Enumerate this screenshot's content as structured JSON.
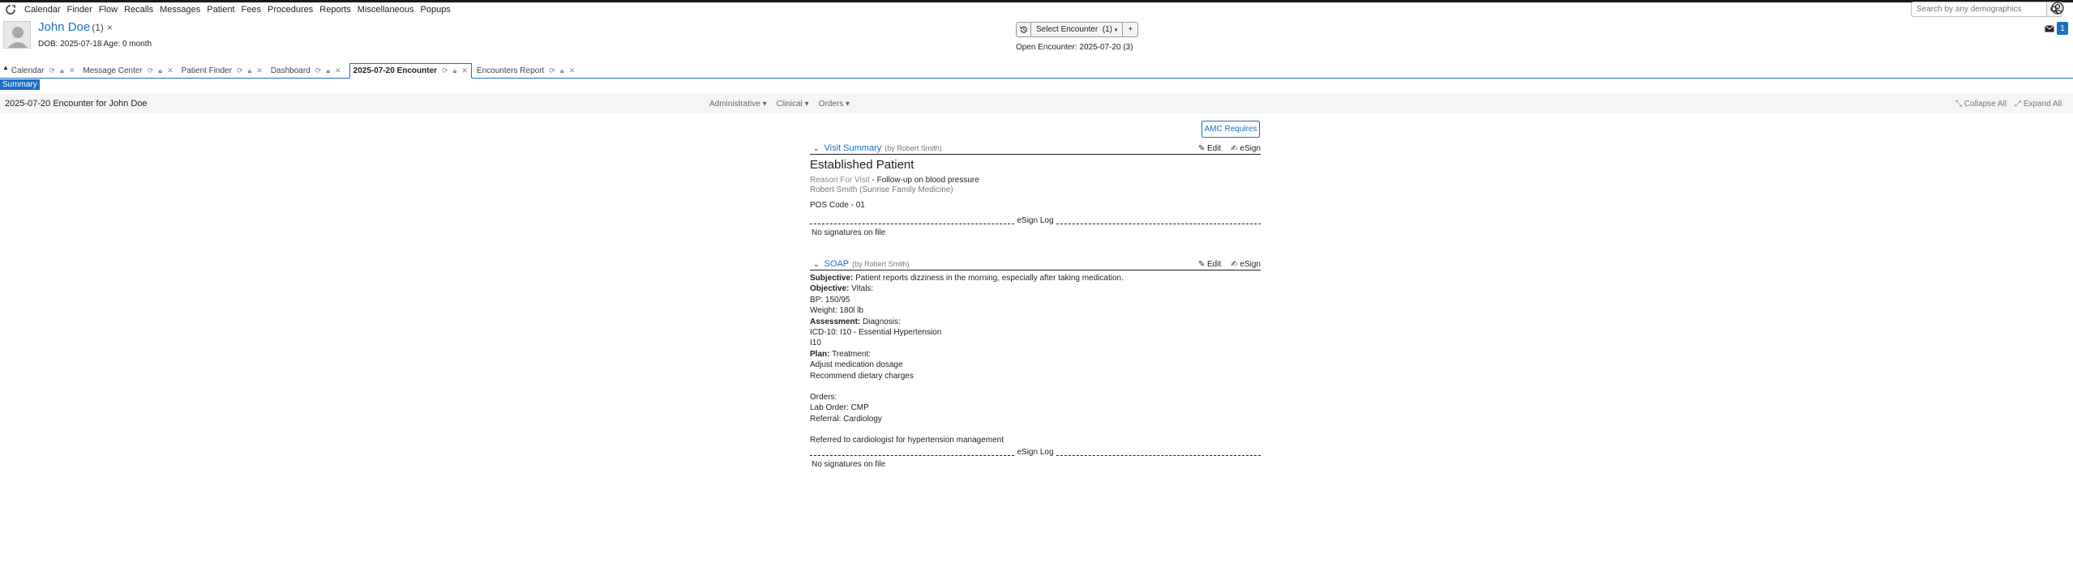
{
  "menubar": {
    "items": [
      "Calendar",
      "Finder",
      "Flow",
      "Recalls",
      "Messages",
      "Patient",
      "Fees",
      "Procedures",
      "Reports",
      "Miscellaneous",
      "Popups"
    ]
  },
  "search": {
    "placeholder": "Search by any demographics"
  },
  "patient": {
    "name": "John Doe",
    "count": "(1)",
    "close": "×",
    "dob_age": "DOB: 2025-07-18 Age: 0 month"
  },
  "encounter_controls": {
    "select_label": "Select Encounter",
    "select_count": "(1)",
    "add": "+",
    "open_encounter": "Open Encounter: 2025-07-20 (3)"
  },
  "notifications": {
    "count": "1"
  },
  "tabs": [
    {
      "label": "Calendar",
      "active": false
    },
    {
      "label": "Message Center",
      "active": false
    },
    {
      "label": "Patient Finder",
      "active": false
    },
    {
      "label": "Dashboard",
      "active": false
    },
    {
      "label": "2025-07-20 Encounter",
      "active": true
    },
    {
      "label": "Encounters Report",
      "active": false
    }
  ],
  "summary_button": "Summary",
  "encounter_header": {
    "title": "2025-07-20 Encounter for John Doe",
    "menus": [
      "Administrative",
      "Clinical",
      "Orders"
    ],
    "collapse_all": "Collapse All",
    "expand_all": "Expand All"
  },
  "amc_button": "AMC Requires",
  "visit_summary": {
    "title": "Visit Summary",
    "by": "(by Robert Smith)",
    "edit": "Edit",
    "esign": "eSign",
    "heading": "Established Patient",
    "reason_key": "Reason For Visit",
    "reason_value": "- Follow-up on blood pressure",
    "provider": "Robert Smith (Sunrise Family Medicine)",
    "pos": "POS Code - 01",
    "esign_log": "eSign Log",
    "no_signatures": "No signatures on file"
  },
  "soap": {
    "title": "SOAP",
    "by": "(by Robert Smith)",
    "edit": "Edit",
    "esign": "eSign",
    "subjective_label": "Subjective:",
    "subjective": "Patient reports dizziness in the morning, especially after taking medication.",
    "objective_label": "Objective:",
    "objective": "Vitals:",
    "bp": "BP: 150/95",
    "weight": "Weight: 180l lb",
    "assessment_label": "Assessment:",
    "assessment": "Diagnosis:",
    "icd": "ICD-10: I10 - Essential Hypertension",
    "i10": "I10",
    "plan_label": "Plan:",
    "plan": "Treatment:",
    "plan_1": "Adjust medication dosage",
    "plan_2": "Recommend dietary charges",
    "orders": "Orders:",
    "lab_order": "Lab Order: CMP",
    "referral": "Referral: Cardiology",
    "referred": "Referred to cardiologist for hypertension management",
    "esign_log": "eSign Log",
    "no_signatures": "No signatures on file"
  }
}
